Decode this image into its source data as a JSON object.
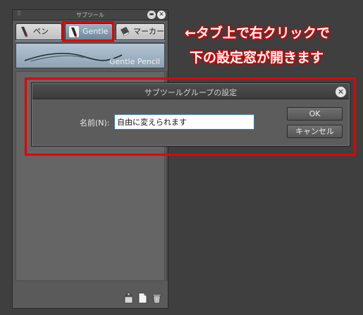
{
  "panel": {
    "title": "サブツール",
    "grip": "⠿",
    "tabs": [
      {
        "label": "ペン",
        "icon": "pen-icon"
      },
      {
        "label": "Gentle",
        "icon": "gentle-pen-icon"
      },
      {
        "label": "マーカー",
        "icon": "marker-icon"
      }
    ],
    "brush_name": "Gentle Pencil",
    "bottom_icons": [
      "sub-tool-settings-icon",
      "new-sub-tool-icon",
      "trash-icon"
    ]
  },
  "annotation": {
    "line1": "←タブ上で右クリックで",
    "line2": "下の設定窓が開きます",
    "color": "#e30000"
  },
  "dialog": {
    "title": "サブツールグループの設定",
    "name_label": "名前(N):",
    "name_value": "自由に変えられます",
    "ok_label": "OK",
    "cancel_label": "キャンセル"
  }
}
